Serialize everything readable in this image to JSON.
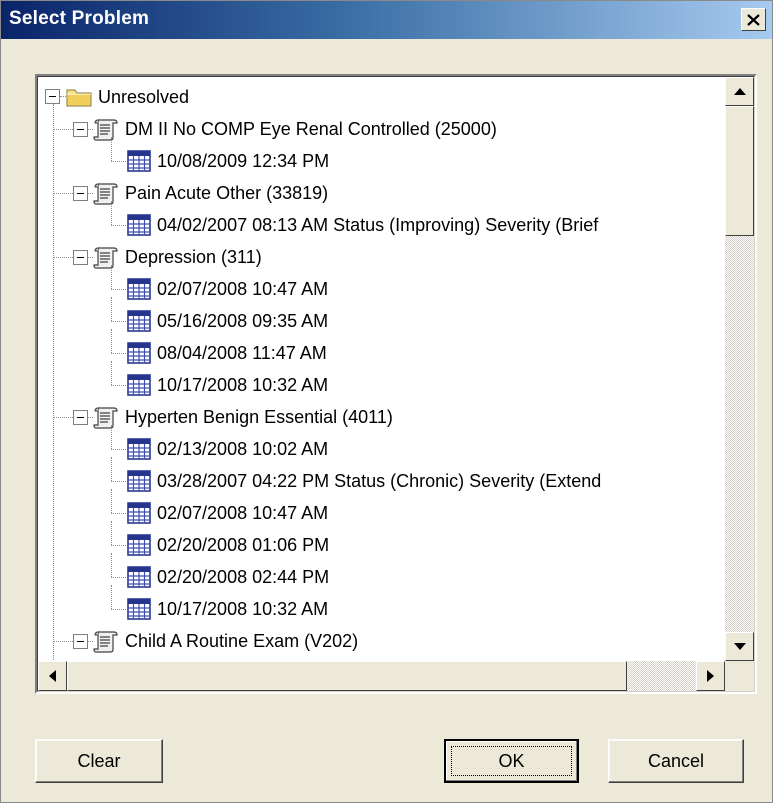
{
  "window": {
    "title": "Select Problem"
  },
  "tree": {
    "root": {
      "label": "Unresolved",
      "icon": "folder-icon"
    },
    "rows": [
      {
        "level": 1,
        "icon": "scroll-icon",
        "label": "DM   II No COMP Eye Renal Controlled (25000)",
        "expander": true
      },
      {
        "level": 2,
        "icon": "calendar-icon",
        "label": "10/08/2009 12:34 PM"
      },
      {
        "level": 1,
        "icon": "scroll-icon",
        "label": "Pain Acute Other (33819)",
        "expander": true
      },
      {
        "level": 2,
        "icon": "calendar-icon",
        "label": "04/02/2007 08:13 AM Status (Improving) Severity (Brief"
      },
      {
        "level": 1,
        "icon": "scroll-icon",
        "label": "Depression (311)",
        "expander": true
      },
      {
        "level": 2,
        "icon": "calendar-icon",
        "label": "02/07/2008 10:47 AM"
      },
      {
        "level": 2,
        "icon": "calendar-icon",
        "label": "05/16/2008 09:35 AM"
      },
      {
        "level": 2,
        "icon": "calendar-icon",
        "label": "08/04/2008 11:47 AM"
      },
      {
        "level": 2,
        "icon": "calendar-icon",
        "label": "10/17/2008 10:32 AM"
      },
      {
        "level": 1,
        "icon": "scroll-icon",
        "label": "Hyperten  Benign Essential (4011)",
        "expander": true
      },
      {
        "level": 2,
        "icon": "calendar-icon",
        "label": "02/13/2008 10:02 AM"
      },
      {
        "level": 2,
        "icon": "calendar-icon",
        "label": "03/28/2007 04:22 PM Status (Chronic) Severity (Extend"
      },
      {
        "level": 2,
        "icon": "calendar-icon",
        "label": "02/07/2008 10:47 AM"
      },
      {
        "level": 2,
        "icon": "calendar-icon",
        "label": "02/20/2008 01:06 PM"
      },
      {
        "level": 2,
        "icon": "calendar-icon",
        "label": "02/20/2008 02:44 PM"
      },
      {
        "level": 2,
        "icon": "calendar-icon",
        "label": "10/17/2008 10:32 AM"
      },
      {
        "level": 1,
        "icon": "scroll-icon",
        "label": "Child A Routine Exam (V202)",
        "expander": true
      }
    ]
  },
  "buttons": {
    "clear": "Clear",
    "ok": "OK",
    "cancel": "Cancel"
  },
  "colors": {
    "titlebar_start": "#0a246a",
    "titlebar_end": "#a6caf0",
    "face": "#ece9d8"
  }
}
